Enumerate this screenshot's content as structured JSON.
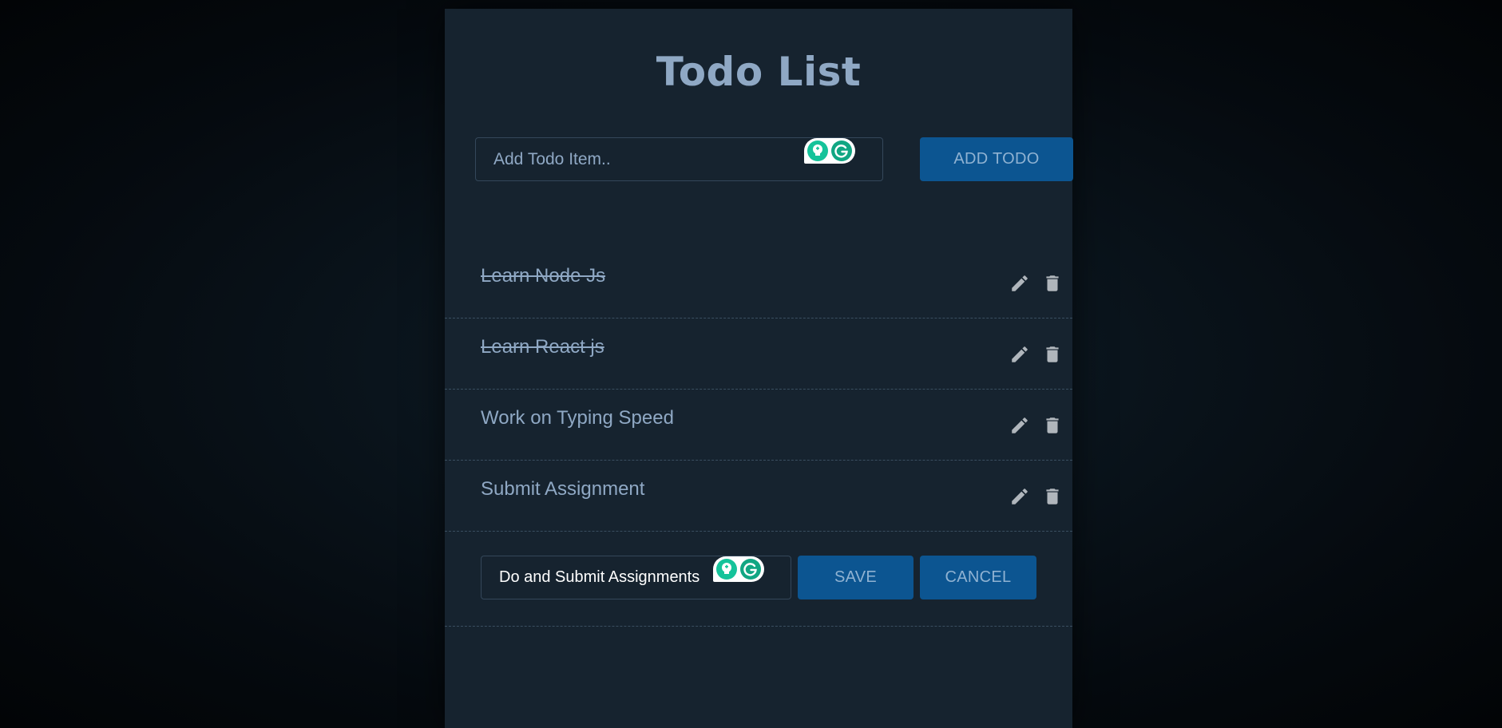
{
  "app": {
    "title": "Todo List"
  },
  "add_form": {
    "input_placeholder": "Add Todo Item..",
    "input_value": "",
    "button_label": "ADD TODO"
  },
  "todos": [
    {
      "text": "Learn Node Js",
      "completed": true
    },
    {
      "text": "Learn React js",
      "completed": true
    },
    {
      "text": "Work on Typing Speed",
      "completed": false
    },
    {
      "text": "Submit Assignment",
      "completed": false
    }
  ],
  "edit_form": {
    "input_value": "Do and Submit Assignments",
    "save_label": "SAVE",
    "cancel_label": "CANCEL"
  },
  "icons": {
    "edit": "pencil-icon",
    "delete": "trash-icon",
    "grammarly_suggest": "lightbulb-icon",
    "grammarly_logo": "grammarly-logo-icon"
  },
  "colors": {
    "page_background": "#050a0f",
    "card_background": "#16232f",
    "title": "#8fa8c4",
    "button_background": "#0c5591",
    "button_text": "#8fb2d2",
    "item_text": "#8fa8c4",
    "icon": "#b0b6bc",
    "grammarly_green": "#15c39a"
  }
}
